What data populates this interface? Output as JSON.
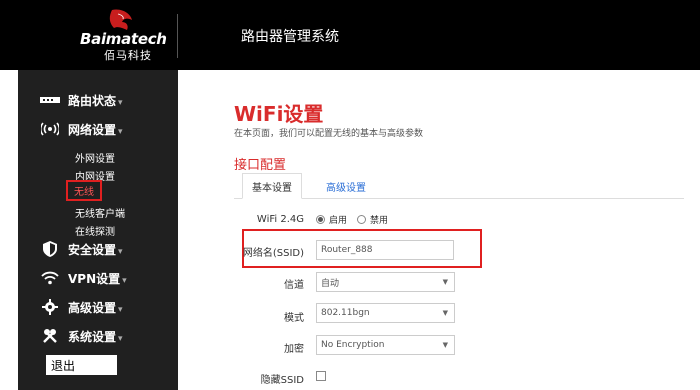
{
  "header": {
    "logo_text": "Baimatech",
    "logo_sub": "佰马科技",
    "title": "路由器管理系统"
  },
  "sidebar": {
    "items": [
      {
        "label": "路由状态",
        "icon": "status-icon"
      },
      {
        "label": "网络设置",
        "icon": "network-icon"
      },
      {
        "label": "安全设置",
        "icon": "shield-icon"
      },
      {
        "label": "VPN设置",
        "icon": "vpn-icon"
      },
      {
        "label": "高级设置",
        "icon": "gear-icon"
      },
      {
        "label": "系统设置",
        "icon": "tools-icon"
      }
    ],
    "caret": "▾",
    "subitems": [
      {
        "label": "外网设置"
      },
      {
        "label": "内网设置"
      },
      {
        "label": "无线",
        "active": true
      },
      {
        "label": "无线客户端"
      },
      {
        "label": "在线探测"
      }
    ],
    "logout_label": "退出"
  },
  "main": {
    "title": "WiFi设置",
    "description": "在本页面，我们可以配置无线的基本与高级参数",
    "section_title": "接口配置",
    "tabs": [
      {
        "label": "基本设置",
        "active": true
      },
      {
        "label": "高级设置",
        "active": false
      }
    ],
    "fields": {
      "wifi_label": "WiFi 2.4G",
      "wifi_options": [
        "启用",
        "禁用"
      ],
      "wifi_selected": "启用",
      "ssid_label": "网络名(SSID)",
      "ssid_value": "Router_888",
      "channel_label": "信道",
      "channel_value": "自动",
      "mode_label": "模式",
      "mode_value": "802.11bgn",
      "encryption_label": "加密",
      "encryption_value": "No Encryption",
      "hidden_ssid_label": "隐藏SSID",
      "hidden_ssid_checked": false
    }
  },
  "colors": {
    "accent": "#d92c2c",
    "link": "#2a6ed6",
    "sidebar_bg": "#202020",
    "header_bg": "#000000"
  }
}
